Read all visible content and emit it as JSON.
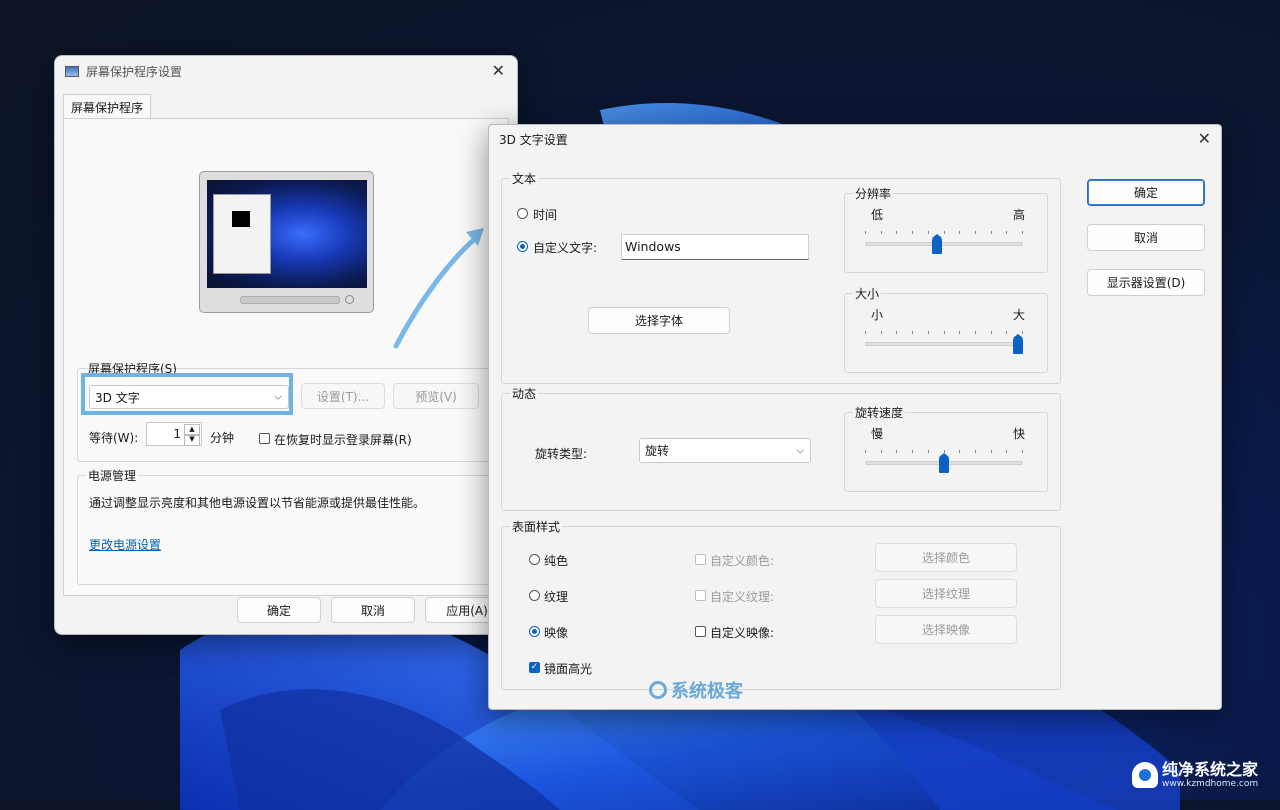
{
  "back_dialog": {
    "title": "屏幕保护程序设置",
    "tab": "屏幕保护程序",
    "saver_group_label": "屏幕保护程序(S)",
    "saver_selected": "3D 文字",
    "settings_button": "设置(T)...",
    "preview_button": "预览(V)",
    "wait_label": "等待(W):",
    "wait_value": "1",
    "minutes_label": "分钟",
    "resume_checkbox_label": "在恢复时显示登录屏幕(R)",
    "power_group_label": "电源管理",
    "power_text": "通过调整显示亮度和其他电源设置以节省能源或提供最佳性能。",
    "power_link": "更改电源设置",
    "ok_button": "确定",
    "cancel_button": "取消",
    "apply_button": "应用(A)"
  },
  "front_dialog": {
    "title": "3D 文字设置",
    "text_group": {
      "label": "文本",
      "time_option": "时间",
      "custom_option": "自定义文字:",
      "custom_value": "Windows",
      "choose_font_button": "选择字体",
      "selected_option": "custom"
    },
    "resolution": {
      "label": "分辨率",
      "low": "低",
      "high": "高",
      "value_fraction": 0.45
    },
    "size": {
      "label": "大小",
      "small": "小",
      "large": "大",
      "value_fraction": 1.0
    },
    "dynamic_group": {
      "label": "动态",
      "rotation_type_label": "旋转类型:",
      "rotation_type_value": "旋转"
    },
    "rotation_speed": {
      "label": "旋转速度",
      "slow": "慢",
      "fast": "快",
      "value_fraction": 0.5
    },
    "surface_group": {
      "label": "表面样式",
      "solid": "纯色",
      "texture": "纹理",
      "reflection": "映像",
      "custom_color": "自定义颜色:",
      "custom_texture": "自定义纹理:",
      "custom_reflection": "自定义映像:",
      "choose_color": "选择颜色",
      "choose_texture": "选择纹理",
      "choose_reflection": "选择映像",
      "specular": "镜面高光",
      "selected_style": "reflection",
      "specular_checked": true
    },
    "ok_button": "确定",
    "cancel_button": "取消",
    "display_settings_button": "显示器设置(D)"
  },
  "watermark_center": "系统极客",
  "watermark_corner": {
    "title": "纯净系统之家",
    "url": "www.kzmdhome.com"
  },
  "colors": {
    "accent": "#0a63c4",
    "highlight_box": "#6fb2e6",
    "arrow": "#7ab8e6"
  }
}
